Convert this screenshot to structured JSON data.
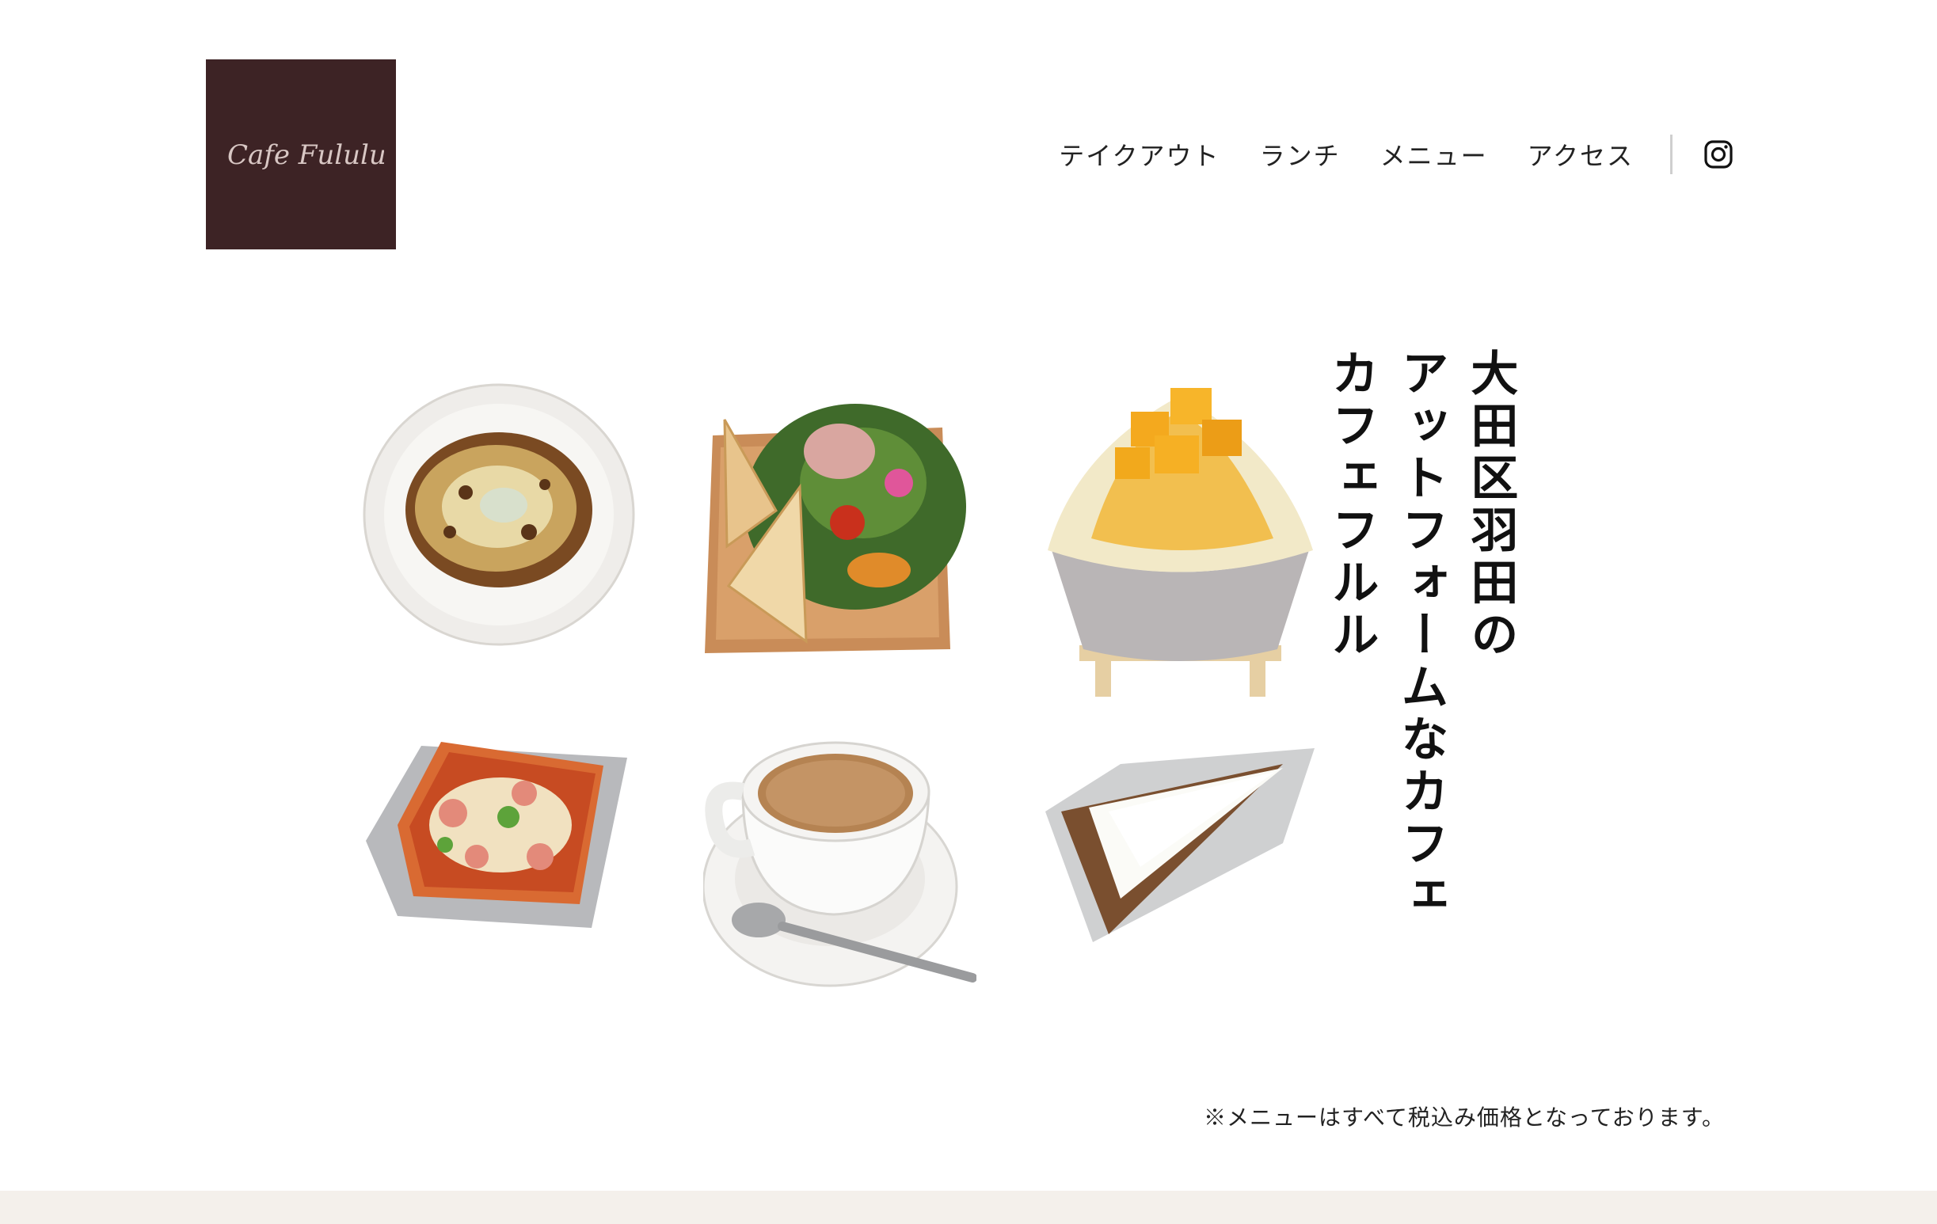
{
  "logo": {
    "text": "Cafe Fululu",
    "bg_color": "#3d2325",
    "text_color": "#d8c7c4",
    "flower_color": "#c2455a"
  },
  "nav": {
    "items": [
      {
        "label": "テイクアウト"
      },
      {
        "label": "ランチ"
      },
      {
        "label": "メニュー"
      },
      {
        "label": "アクセス"
      }
    ],
    "social_icon": "instagram-icon"
  },
  "hero": {
    "headline_lines": [
      "大田区羽田の",
      "アットフォームなカフェ",
      "カフェフルル"
    ]
  },
  "food_images": [
    "doria-plate",
    "salad-toast-plate",
    "mango-shaved-ice",
    "pizza-toast",
    "coffee-cup",
    "rare-cheesecake"
  ],
  "note": "※メニューはすべて税込み価格となっております。",
  "colors": {
    "footer_band": "#f4f0eb"
  }
}
